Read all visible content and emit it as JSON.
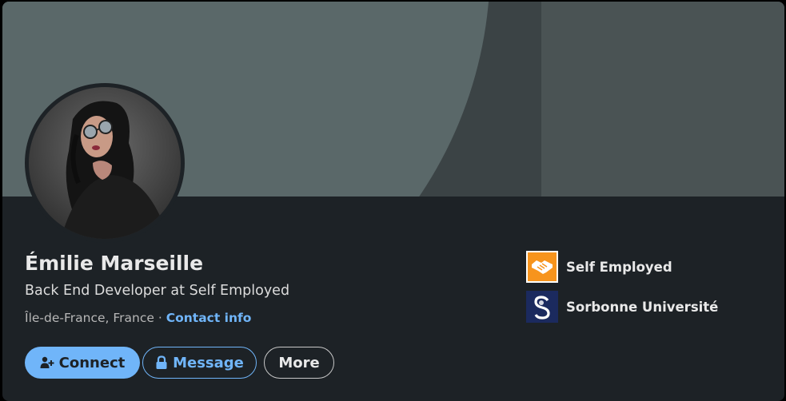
{
  "profile": {
    "name": "Émilie Marseille",
    "headline": "Back End Developer at Self Employed",
    "location": "Île-de-France, France",
    "separator": "·",
    "contact_label": "Contact info"
  },
  "actions": {
    "connect_label": "Connect",
    "message_label": "Message",
    "more_label": "More"
  },
  "organizations": [
    {
      "name": "Self Employed",
      "logo": "handshake-icon",
      "color": "#f7941d"
    },
    {
      "name": "Sorbonne Université",
      "logo": "sorbonne-logo",
      "color": "#1b2a5e"
    }
  ],
  "theme": {
    "card_bg": "#1d2226",
    "accent": "#70b5f9",
    "banner_light": "#5a6869",
    "banner_dark": "#3b4345"
  }
}
